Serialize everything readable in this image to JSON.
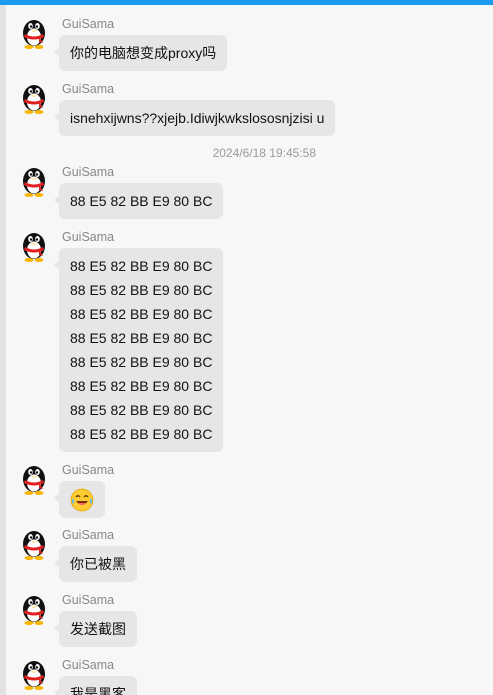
{
  "theme": {
    "accent": "#1a9af0",
    "bubble_bg": "#e6e6e6",
    "sender_color": "#888888"
  },
  "messages": [
    {
      "sender": "GuiSama",
      "avatar_icon": "qq-penguin-icon",
      "lines": [
        "你的电脑想变成proxy吗"
      ]
    },
    {
      "sender": "GuiSama",
      "avatar_icon": "qq-penguin-icon",
      "lines": [
        "isnehxijwns??xjejb.Idiwjkwkslososnjzisi u"
      ]
    },
    {
      "timestamp": "2024/6/18 19:45:58"
    },
    {
      "sender": "GuiSama",
      "avatar_icon": "qq-penguin-icon",
      "lines": [
        "88 E5 82 BB E9 80 BC"
      ]
    },
    {
      "sender": "GuiSama",
      "avatar_icon": "qq-penguin-icon",
      "lines": [
        "88 E5 82 BB E9 80 BC",
        "88 E5 82 BB E9 80 BC",
        "88 E5 82 BB E9 80 BC",
        "88 E5 82 BB E9 80 BC",
        "88 E5 82 BB E9 80 BC",
        "88 E5 82 BB E9 80 BC",
        "88 E5 82 BB E9 80 BC",
        "88 E5 82 BB E9 80 BC"
      ]
    },
    {
      "sender": "GuiSama",
      "avatar_icon": "qq-penguin-icon",
      "emoji": "laughing-tears-emoji-icon"
    },
    {
      "sender": "GuiSama",
      "avatar_icon": "qq-penguin-icon",
      "lines": [
        "你已被黑"
      ]
    },
    {
      "sender": "GuiSama",
      "avatar_icon": "qq-penguin-icon",
      "lines": [
        "发送截图"
      ]
    },
    {
      "sender": "GuiSama",
      "avatar_icon": "qq-penguin-icon",
      "lines": [
        "我是黑客"
      ]
    }
  ]
}
